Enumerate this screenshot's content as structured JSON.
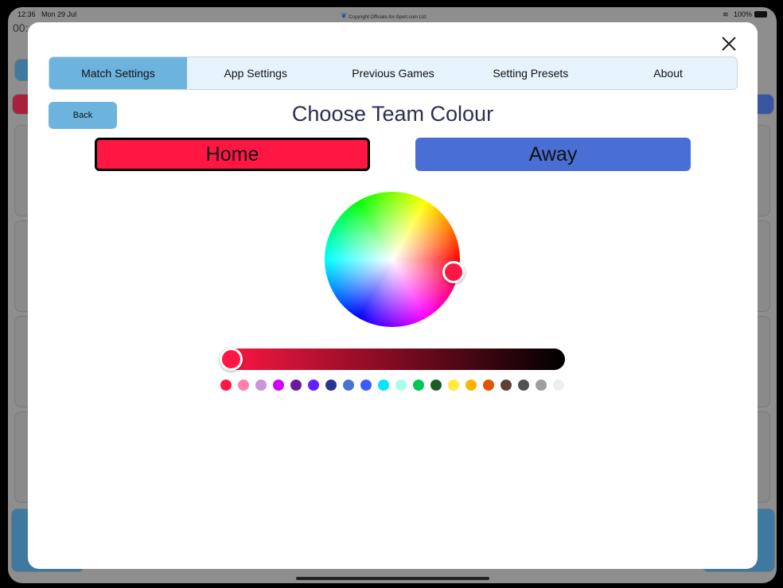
{
  "status_bar": {
    "time": "12:36",
    "date": "Mon 29 Jul",
    "copyright": "Copyright Officials-for-Sport.com Ltd.",
    "battery": "100%"
  },
  "background": {
    "timer_partial": "00:"
  },
  "modal": {
    "tabs": [
      {
        "label": "Match Settings",
        "selected": true
      },
      {
        "label": "App Settings"
      },
      {
        "label": "Previous Games"
      },
      {
        "label": "Setting Presets"
      },
      {
        "label": "About"
      }
    ],
    "back_label": "Back",
    "title": "Choose Team Colour",
    "home_label": "Home",
    "home_color": "#ff1744",
    "away_label": "Away",
    "away_color": "#4a6fd4",
    "selected_color": "#ff1744",
    "brightness": 1.0,
    "swatches": [
      "#ff1744",
      "#ff80ab",
      "#ce93d8",
      "#d500f9",
      "#6a1b9a",
      "#651fff",
      "#283593",
      "#4a74d0",
      "#3d5afe",
      "#00e5ff",
      "#a7ffeb",
      "#00c853",
      "#1b5e20",
      "#ffeb3b",
      "#ffb300",
      "#e65100",
      "#5d4037",
      "#515151",
      "#9e9e9e",
      "#eeeeee"
    ]
  }
}
